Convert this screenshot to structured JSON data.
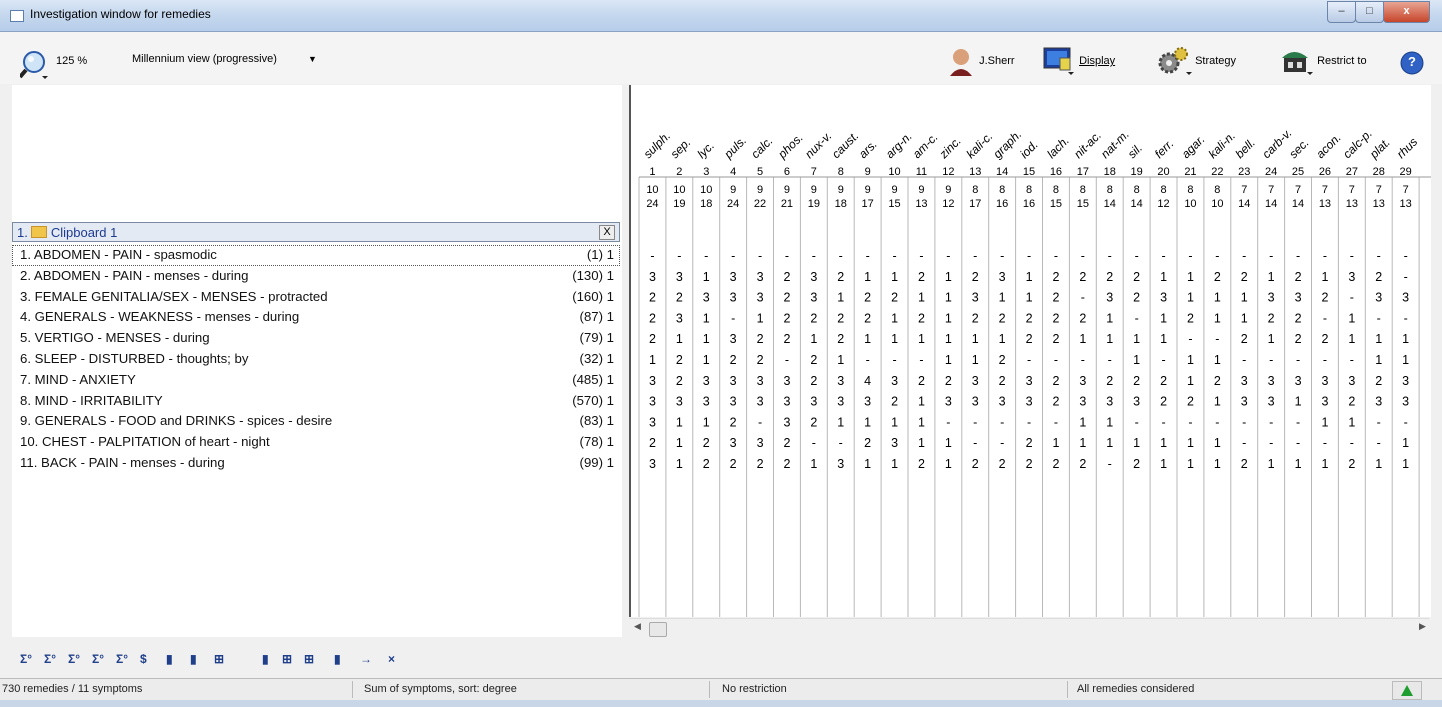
{
  "window": {
    "title": "Investigation window for remedies",
    "min": "–",
    "max": "□",
    "close": "x"
  },
  "toolbar": {
    "zoom": "125 %",
    "view": "Millennium view (progressive)",
    "user": "J.Sherr",
    "display": "Display",
    "strategy": "Strategy",
    "restrict": "Restrict to",
    "help": "?"
  },
  "clipboard": {
    "label": "1.",
    "name": "Clipboard 1",
    "close": "X"
  },
  "symptoms": [
    {
      "text": "1. ABDOMEN - PAIN - spasmodic",
      "count": "(1) 1"
    },
    {
      "text": "2. ABDOMEN - PAIN - menses - during",
      "count": "(130) 1"
    },
    {
      "text": "3. FEMALE GENITALIA/SEX - MENSES - protracted",
      "count": "(160) 1"
    },
    {
      "text": "4. GENERALS - WEAKNESS - menses - during",
      "count": "(87) 1"
    },
    {
      "text": "5. VERTIGO - MENSES - during",
      "count": "(79) 1"
    },
    {
      "text": "6. SLEEP - DISTURBED - thoughts; by",
      "count": "(32) 1"
    },
    {
      "text": "7. MIND - ANXIETY",
      "count": "(485) 1"
    },
    {
      "text": "8. MIND - IRRITABILITY",
      "count": "(570) 1"
    },
    {
      "text": "9. GENERALS - FOOD and DRINKS - spices - desire",
      "count": "(83) 1"
    },
    {
      "text": "10. CHEST - PALPITATION of heart - night",
      "count": "(78) 1"
    },
    {
      "text": "11. BACK - PAIN - menses - during",
      "count": "(99) 1"
    }
  ],
  "remedies": [
    {
      "name": "sulph.",
      "rank": "1",
      "symptoms": "10",
      "degree": "24"
    },
    {
      "name": "sep.",
      "rank": "2",
      "symptoms": "10",
      "degree": "19"
    },
    {
      "name": "lyc.",
      "rank": "3",
      "symptoms": "10",
      "degree": "18"
    },
    {
      "name": "puls.",
      "rank": "4",
      "symptoms": "9",
      "degree": "24"
    },
    {
      "name": "calc.",
      "rank": "5",
      "symptoms": "9",
      "degree": "22"
    },
    {
      "name": "phos.",
      "rank": "6",
      "symptoms": "9",
      "degree": "21"
    },
    {
      "name": "nux-v.",
      "rank": "7",
      "symptoms": "9",
      "degree": "19"
    },
    {
      "name": "caust.",
      "rank": "8",
      "symptoms": "9",
      "degree": "18"
    },
    {
      "name": "ars.",
      "rank": "9",
      "symptoms": "9",
      "degree": "17"
    },
    {
      "name": "arg-n.",
      "rank": "10",
      "symptoms": "9",
      "degree": "15"
    },
    {
      "name": "am-c.",
      "rank": "11",
      "symptoms": "9",
      "degree": "13"
    },
    {
      "name": "zinc.",
      "rank": "12",
      "symptoms": "9",
      "degree": "12"
    },
    {
      "name": "kali-c.",
      "rank": "13",
      "symptoms": "8",
      "degree": "17"
    },
    {
      "name": "graph.",
      "rank": "14",
      "symptoms": "8",
      "degree": "16"
    },
    {
      "name": "iod.",
      "rank": "15",
      "symptoms": "8",
      "degree": "16"
    },
    {
      "name": "lach.",
      "rank": "16",
      "symptoms": "8",
      "degree": "15"
    },
    {
      "name": "nit-ac.",
      "rank": "17",
      "symptoms": "8",
      "degree": "15"
    },
    {
      "name": "nat-m.",
      "rank": "18",
      "symptoms": "8",
      "degree": "14"
    },
    {
      "name": "sil.",
      "rank": "19",
      "symptoms": "8",
      "degree": "14"
    },
    {
      "name": "ferr.",
      "rank": "20",
      "symptoms": "8",
      "degree": "12"
    },
    {
      "name": "agar.",
      "rank": "21",
      "symptoms": "8",
      "degree": "10"
    },
    {
      "name": "kali-n.",
      "rank": "22",
      "symptoms": "8",
      "degree": "10"
    },
    {
      "name": "bell.",
      "rank": "23",
      "symptoms": "7",
      "degree": "14"
    },
    {
      "name": "carb-v.",
      "rank": "24",
      "symptoms": "7",
      "degree": "14"
    },
    {
      "name": "sec.",
      "rank": "25",
      "symptoms": "7",
      "degree": "14"
    },
    {
      "name": "acon.",
      "rank": "26",
      "symptoms": "7",
      "degree": "13"
    },
    {
      "name": "calc-p.",
      "rank": "27",
      "symptoms": "7",
      "degree": "13"
    },
    {
      "name": "plat.",
      "rank": "28",
      "symptoms": "7",
      "degree": "13"
    },
    {
      "name": "rhus",
      "rank": "29",
      "symptoms": "7",
      "degree": "13"
    }
  ],
  "grid": [
    [
      "-",
      "-",
      "-",
      "-",
      "-",
      "-",
      "-",
      "-",
      "-",
      "-",
      "-",
      "-",
      "-",
      "-",
      "-",
      "-",
      "-",
      "-",
      "-",
      "-",
      "-",
      "-",
      "-",
      "-",
      "-",
      "-",
      "-",
      "-",
      "-"
    ],
    [
      "3",
      "3",
      "1",
      "3",
      "3",
      "2",
      "3",
      "2",
      "1",
      "1",
      "2",
      "1",
      "2",
      "3",
      "1",
      "2",
      "2",
      "2",
      "2",
      "1",
      "1",
      "2",
      "2",
      "1",
      "2",
      "1",
      "3",
      "2",
      "-"
    ],
    [
      "2",
      "2",
      "3",
      "3",
      "3",
      "2",
      "3",
      "1",
      "2",
      "2",
      "1",
      "1",
      "3",
      "1",
      "1",
      "2",
      "-",
      "3",
      "2",
      "3",
      "1",
      "1",
      "1",
      "3",
      "3",
      "2",
      "-",
      "3",
      "3"
    ],
    [
      "2",
      "3",
      "1",
      "-",
      "1",
      "2",
      "2",
      "2",
      "2",
      "1",
      "2",
      "1",
      "2",
      "2",
      "2",
      "2",
      "2",
      "1",
      "-",
      "1",
      "2",
      "1",
      "1",
      "2",
      "2",
      "-",
      "1",
      "-",
      "-"
    ],
    [
      "2",
      "1",
      "1",
      "3",
      "2",
      "2",
      "1",
      "2",
      "1",
      "1",
      "1",
      "1",
      "1",
      "1",
      "2",
      "2",
      "1",
      "1",
      "1",
      "1",
      "-",
      "-",
      "2",
      "1",
      "2",
      "2",
      "1",
      "1",
      "1"
    ],
    [
      "1",
      "2",
      "1",
      "2",
      "2",
      "-",
      "2",
      "1",
      "-",
      "-",
      "-",
      "1",
      "1",
      "2",
      "-",
      "-",
      "-",
      "-",
      "1",
      "-",
      "1",
      "1",
      "-",
      "-",
      "-",
      "-",
      "-",
      "1",
      "1"
    ],
    [
      "3",
      "2",
      "3",
      "3",
      "3",
      "3",
      "2",
      "3",
      "4",
      "3",
      "2",
      "2",
      "3",
      "2",
      "3",
      "2",
      "3",
      "2",
      "2",
      "2",
      "1",
      "2",
      "3",
      "3",
      "3",
      "3",
      "3",
      "2",
      "3"
    ],
    [
      "3",
      "3",
      "3",
      "3",
      "3",
      "3",
      "3",
      "3",
      "3",
      "2",
      "1",
      "3",
      "3",
      "3",
      "3",
      "2",
      "3",
      "3",
      "3",
      "2",
      "2",
      "1",
      "3",
      "3",
      "1",
      "3",
      "2",
      "3",
      "3"
    ],
    [
      "3",
      "1",
      "1",
      "2",
      "-",
      "3",
      "2",
      "1",
      "1",
      "1",
      "1",
      "-",
      "-",
      "-",
      "-",
      "-",
      "1",
      "1",
      "-",
      "-",
      "-",
      "-",
      "-",
      "-",
      "-",
      "1",
      "1",
      "-",
      "-"
    ],
    [
      "2",
      "1",
      "2",
      "3",
      "3",
      "2",
      "-",
      "-",
      "2",
      "3",
      "1",
      "1",
      "-",
      "-",
      "2",
      "1",
      "1",
      "1",
      "1",
      "1",
      "1",
      "1",
      "-",
      "-",
      "-",
      "-",
      "-",
      "-",
      "1"
    ],
    [
      "3",
      "1",
      "2",
      "2",
      "2",
      "2",
      "1",
      "3",
      "1",
      "1",
      "2",
      "1",
      "2",
      "2",
      "2",
      "2",
      "2",
      "-",
      "2",
      "1",
      "1",
      "1",
      "2",
      "1",
      "1",
      "1",
      "2",
      "1",
      "1"
    ]
  ],
  "bottom_icons": [
    "Σ°",
    "Σ°",
    "Σ°",
    "Σ°",
    "Σ°",
    "$",
    "▮",
    "▮",
    "⊞",
    "▮",
    "⊞",
    "⊞",
    "▮",
    "→",
    "×"
  ],
  "status": {
    "counts": "730 remedies / 11 symptoms",
    "sort": "Sum of symptoms, sort: degree",
    "restriction": "No restriction",
    "remedies": "All remedies considered"
  }
}
